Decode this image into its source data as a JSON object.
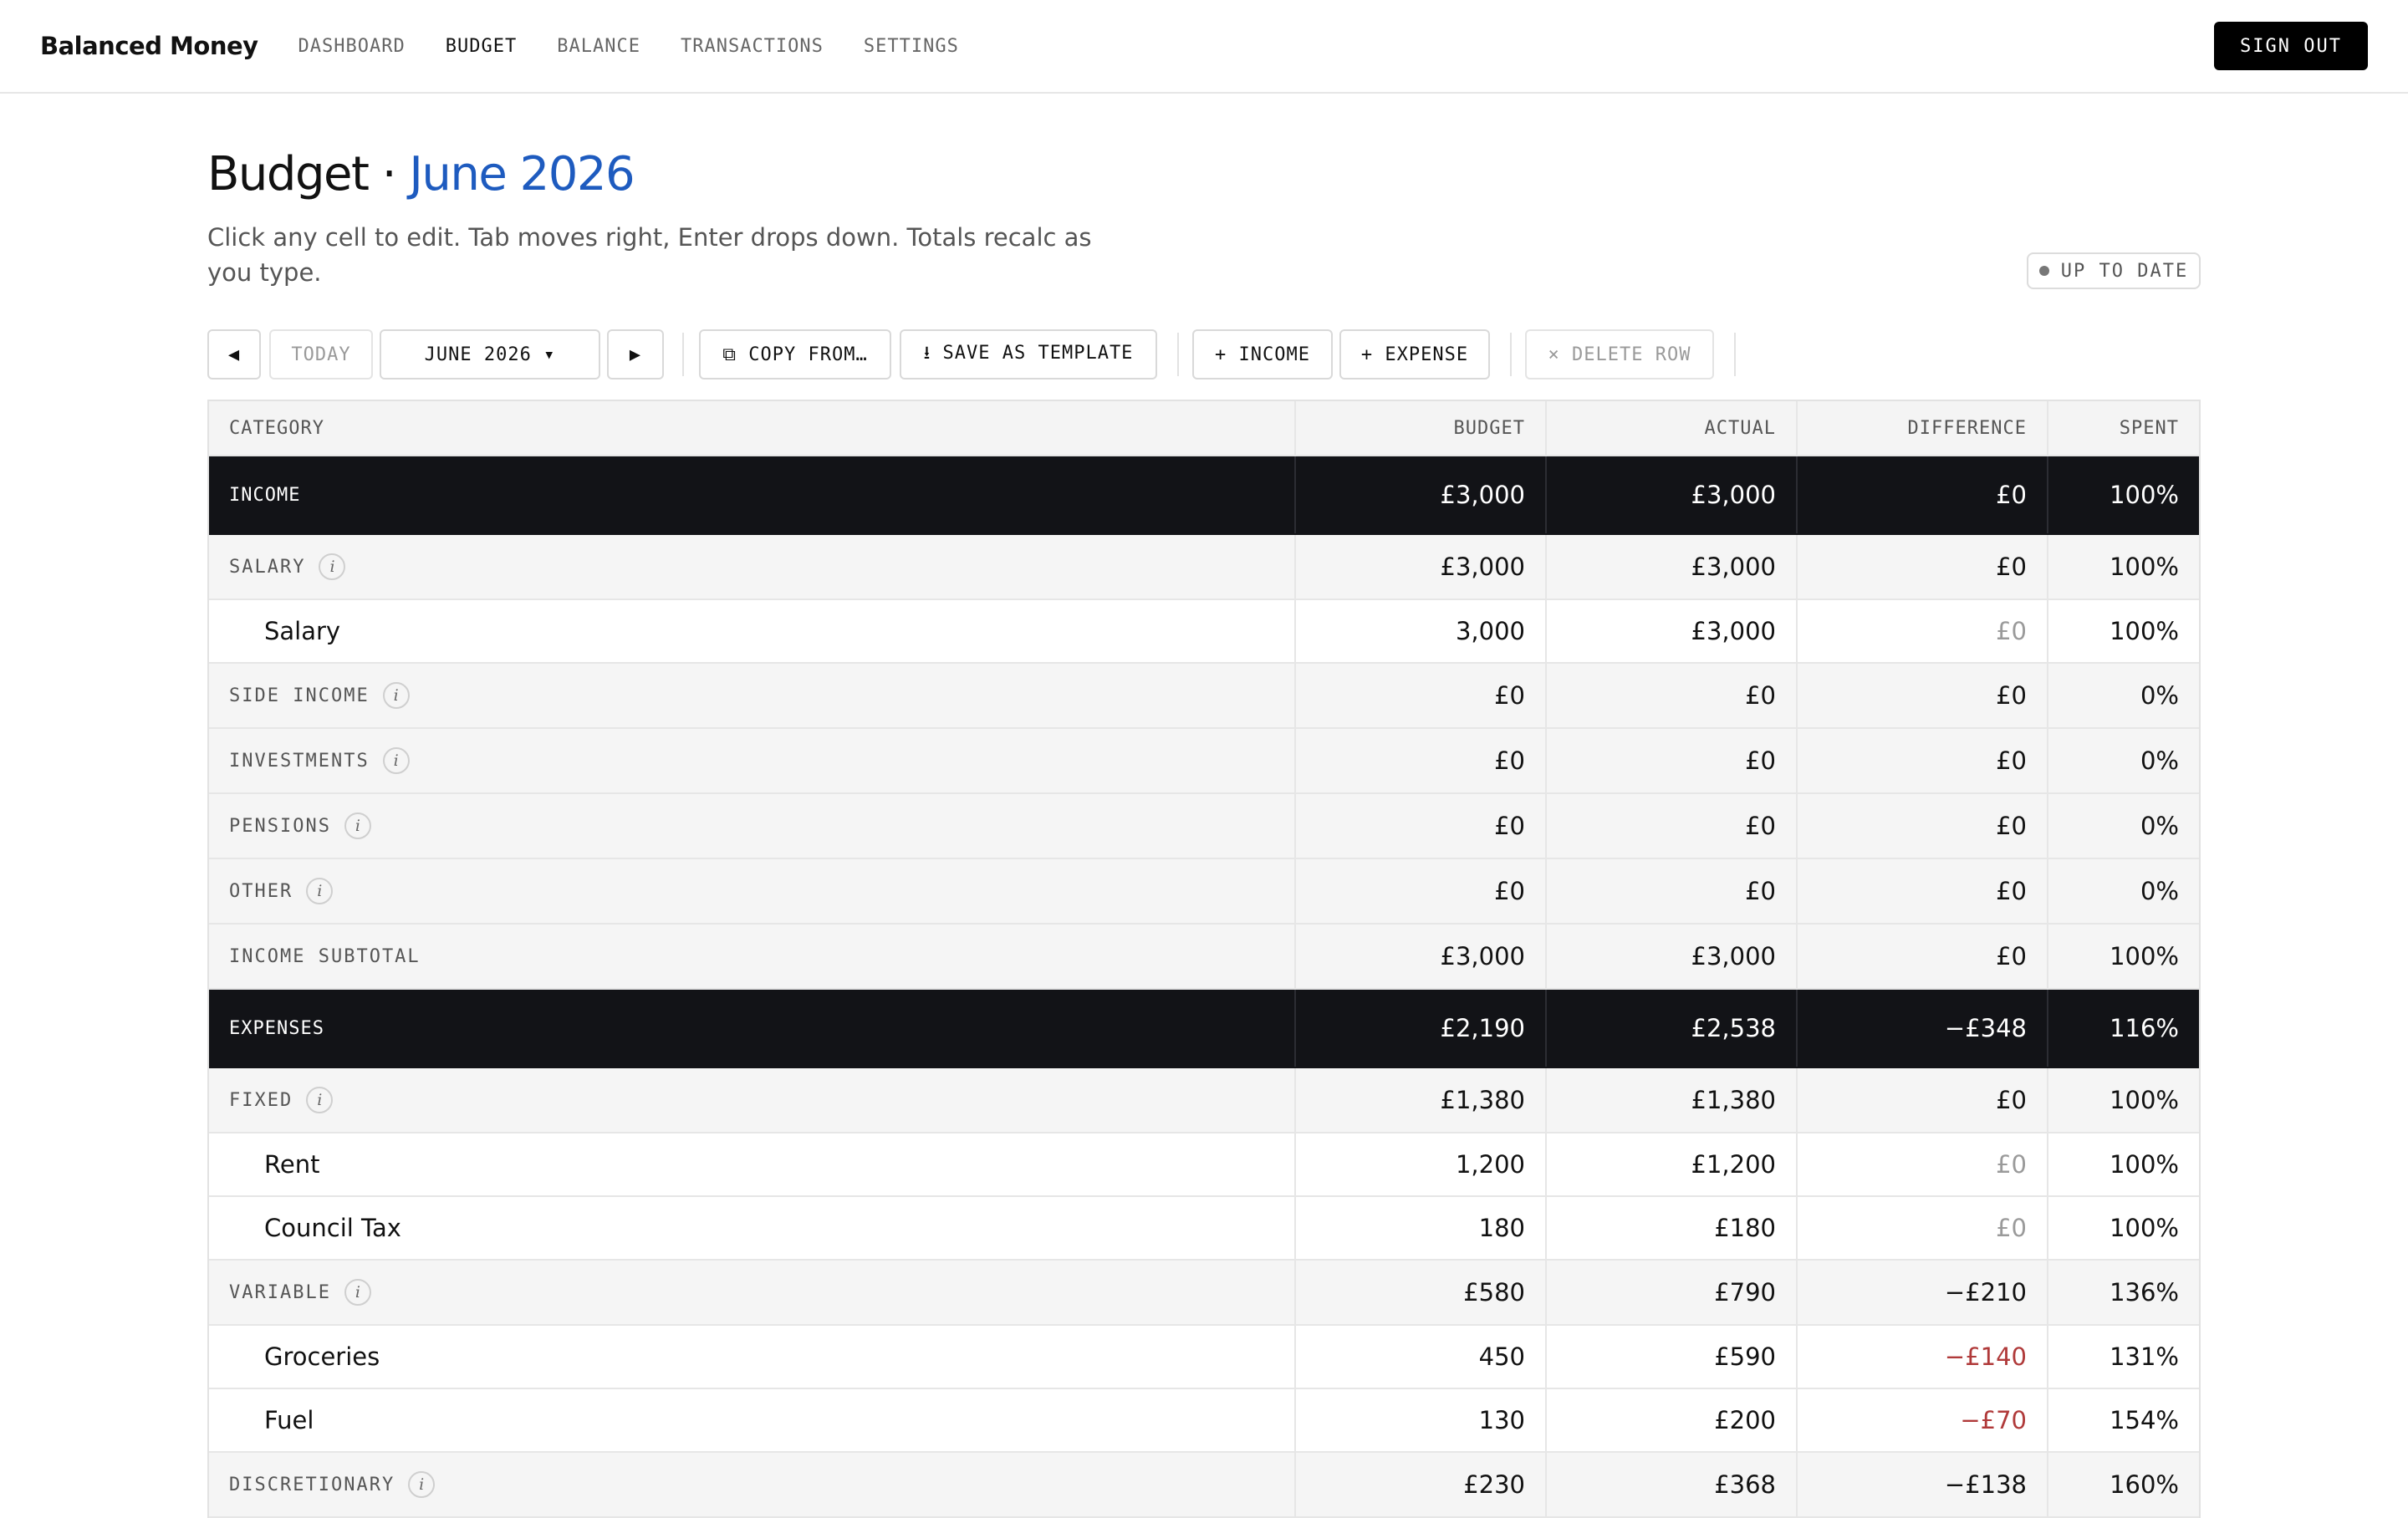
{
  "nav": {
    "brand": "Balanced Money",
    "links": [
      "DASHBOARD",
      "BUDGET",
      "BALANCE",
      "TRANSACTIONS",
      "SETTINGS"
    ],
    "active": "BUDGET",
    "signout_label": "SIGN OUT"
  },
  "header": {
    "title_prefix": "Budget · ",
    "title_month": "June 2026",
    "subtitle": "Click any cell to edit. Tab moves right, Enter drops down. Totals recalc as you type.",
    "status": "UP TO DATE"
  },
  "toolbar": {
    "prev": "◀",
    "today": "TODAY",
    "month_select": "JUNE 2026 ▾",
    "next": "▶",
    "copy_from": "⧉ COPY FROM…",
    "save_template": "⭳ SAVE AS TEMPLATE",
    "add_income": "+ INCOME",
    "add_expense": "+ EXPENSE",
    "delete_row": "× DELETE ROW"
  },
  "table": {
    "columns": [
      "CATEGORY",
      "BUDGET",
      "ACTUAL",
      "DIFFERENCE",
      "SPENT"
    ],
    "rows": [
      {
        "kind": "section",
        "name": "INCOME",
        "budget": "£3,000",
        "actual": "£3,000",
        "difference": "£0",
        "spent": "100%"
      },
      {
        "kind": "group",
        "name": "SALARY",
        "info": "i",
        "budget": "£3,000",
        "actual": "£3,000",
        "difference": "£0",
        "spent": "100%"
      },
      {
        "kind": "item",
        "name": "Salary",
        "budget": "3,000",
        "actual": "£3,000",
        "difference": "£0",
        "spent": "100%",
        "diff_style": "zero"
      },
      {
        "kind": "group",
        "name": "SIDE INCOME",
        "info": "i",
        "budget": "£0",
        "actual": "£0",
        "difference": "£0",
        "spent": "0%"
      },
      {
        "kind": "group",
        "name": "INVESTMENTS",
        "info": "i",
        "budget": "£0",
        "actual": "£0",
        "difference": "£0",
        "spent": "0%"
      },
      {
        "kind": "group",
        "name": "PENSIONS",
        "info": "i",
        "budget": "£0",
        "actual": "£0",
        "difference": "£0",
        "spent": "0%"
      },
      {
        "kind": "group",
        "name": "OTHER",
        "info": "i",
        "budget": "£0",
        "actual": "£0",
        "difference": "£0",
        "spent": "0%"
      },
      {
        "kind": "group",
        "name": "INCOME SUBTOTAL",
        "budget": "£3,000",
        "actual": "£3,000",
        "difference": "£0",
        "spent": "100%"
      },
      {
        "kind": "section",
        "name": "EXPENSES",
        "budget": "£2,190",
        "actual": "£2,538",
        "difference": "−£348",
        "spent": "116%"
      },
      {
        "kind": "group",
        "name": "FIXED",
        "info": "i",
        "budget": "£1,380",
        "actual": "£1,380",
        "difference": "£0",
        "spent": "100%"
      },
      {
        "kind": "item",
        "name": "Rent",
        "budget": "1,200",
        "actual": "£1,200",
        "difference": "£0",
        "spent": "100%",
        "diff_style": "zero"
      },
      {
        "kind": "item",
        "name": "Council Tax",
        "budget": "180",
        "actual": "£180",
        "difference": "£0",
        "spent": "100%",
        "diff_style": "zero"
      },
      {
        "kind": "group",
        "name": "VARIABLE",
        "info": "i",
        "budget": "£580",
        "actual": "£790",
        "difference": "−£210",
        "spent": "136%"
      },
      {
        "kind": "item",
        "name": "Groceries",
        "budget": "450",
        "actual": "£590",
        "difference": "−£140",
        "spent": "131%",
        "diff_style": "neg"
      },
      {
        "kind": "item",
        "name": "Fuel",
        "budget": "130",
        "actual": "£200",
        "difference": "−£70",
        "spent": "154%",
        "diff_style": "neg"
      },
      {
        "kind": "group",
        "name": "DISCRETIONARY",
        "info": "i",
        "budget": "£230",
        "actual": "£368",
        "difference": "−£138",
        "spent": "160%"
      }
    ]
  }
}
